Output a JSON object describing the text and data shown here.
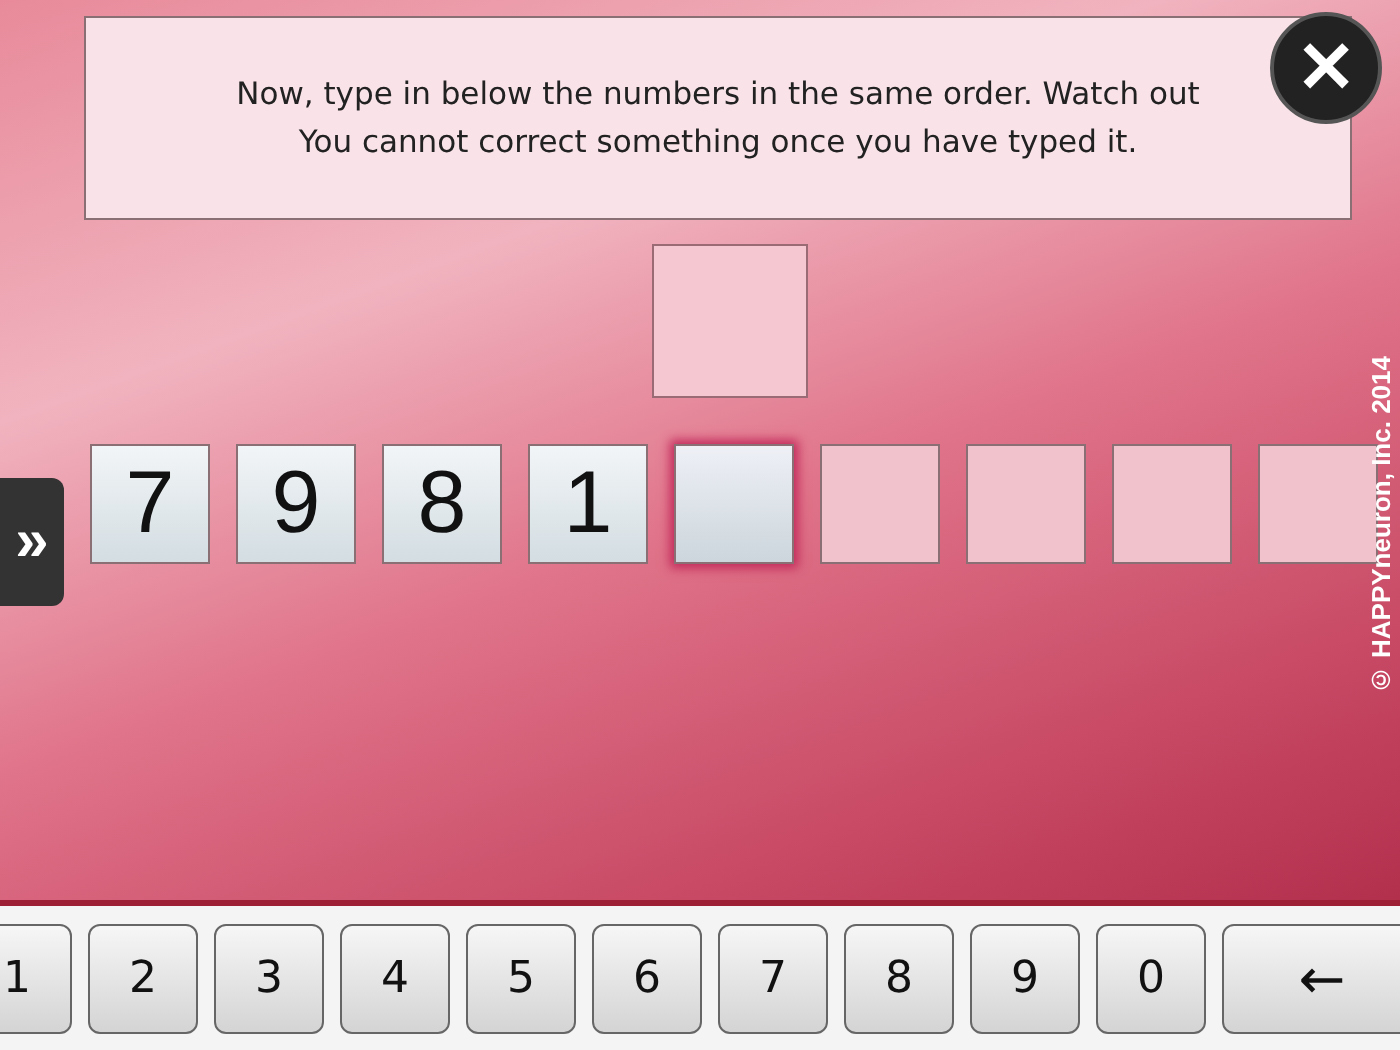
{
  "message": {
    "lines": [
      "Now, type in below the numbers in the same order. Watch out",
      "You cannot correct something once you have typed it."
    ]
  },
  "close_button": {
    "label": "✕"
  },
  "side_tab": {
    "label": "»"
  },
  "slots": [
    {
      "kind": "entered",
      "value": "7"
    },
    {
      "kind": "entered",
      "value": "9"
    },
    {
      "kind": "entered",
      "value": "8"
    },
    {
      "kind": "entered",
      "value": "1"
    },
    {
      "kind": "current"
    },
    {
      "kind": "empty"
    },
    {
      "kind": "empty"
    },
    {
      "kind": "empty"
    },
    {
      "kind": "empty"
    }
  ],
  "copyright": "© HAPPYneuron, Inc. 2014",
  "keypad": {
    "keys": [
      "1",
      "2",
      "3",
      "4",
      "5",
      "6",
      "7",
      "8",
      "9",
      "0"
    ],
    "backspace": "←"
  }
}
